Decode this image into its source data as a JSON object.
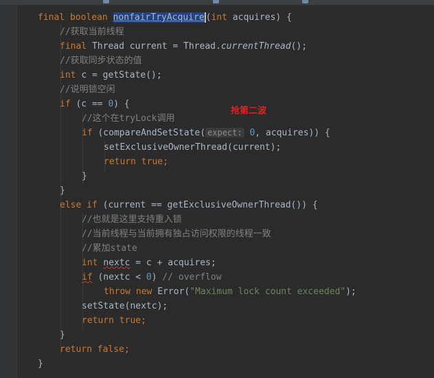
{
  "annotation": "抢第二波",
  "code": {
    "l1": {
      "t1": "final",
      "t2": "boolean",
      "t3": "nonfairTryAcquire",
      "t4": "(",
      "t5": "int",
      "t6": "acquires) {"
    },
    "l2": {
      "t1": "//获取当前线程"
    },
    "l3": {
      "t1": "final",
      "t2": "Thread current = Thread.",
      "t3": "currentThread",
      "t4": "();"
    },
    "l4": {
      "t1": "//获取同步状态的值"
    },
    "l5": {
      "t1": "int",
      "t2": "c = getState();"
    },
    "l6": {
      "t1": "//说明锁空闲"
    },
    "l7": {
      "t1": "if",
      "t2": "(c == ",
      "t3": "0",
      "t4": ") {"
    },
    "l8": {
      "t1": "//这个在tryLock调用"
    },
    "l9": {
      "t1": "if",
      "t2": "(compareAndSetState(",
      "t3": "expect:",
      "t4": "0",
      "t5": ", acquires)) {"
    },
    "l10": {
      "t1": "setExclusiveOwnerThread(current);"
    },
    "l11": {
      "t1": "return",
      "t2": "true",
      "t3": ";"
    },
    "l12": {
      "t1": "}"
    },
    "l13": {
      "t1": "}"
    },
    "l14": {
      "t1": "else",
      "t2": "if",
      "t3": "(current == getExclusiveOwnerThread()) {"
    },
    "l15": {
      "t1": "//也就是这里支持重入锁"
    },
    "l16": {
      "t1": "//当前线程与当前拥有独占访问权限的线程一致"
    },
    "l17": {
      "t1": "//累加state"
    },
    "l18": {
      "t1": "int",
      "t2": "nextc",
      "t3": "= c + acquires;"
    },
    "l19": {
      "t1": "if",
      "t2": "(nextc < ",
      "t3": "0",
      "t4": ")",
      "t5": "// overflow"
    },
    "l20": {
      "t1": "throw",
      "t2": "new",
      "t3": "Error(",
      "t4": "\"Maximum lock count exceeded\"",
      "t5": ");"
    },
    "l21": {
      "t1": "setState(nextc);"
    },
    "l22": {
      "t1": "return",
      "t2": "true",
      "t3": ";"
    },
    "l23": {
      "t1": "}"
    },
    "l24": {
      "t1": "return",
      "t2": "false",
      "t3": ";"
    },
    "l25": {
      "t1": "}"
    }
  }
}
